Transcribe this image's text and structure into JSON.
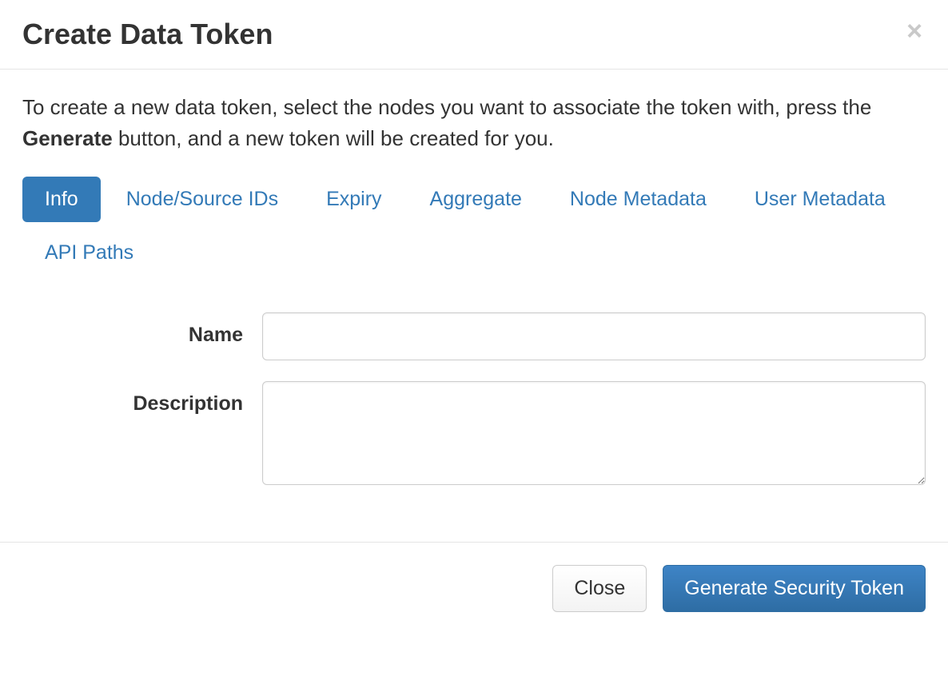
{
  "header": {
    "title": "Create Data Token",
    "close_glyph": "×"
  },
  "intro": {
    "pre": "To create a new data token, select the nodes you want to associate the token with, press the ",
    "bold": "Generate",
    "post": " button, and a new token will be created for you."
  },
  "tabs": [
    {
      "label": "Info",
      "active": true
    },
    {
      "label": "Node/Source IDs",
      "active": false
    },
    {
      "label": "Expiry",
      "active": false
    },
    {
      "label": "Aggregate",
      "active": false
    },
    {
      "label": "Node Metadata",
      "active": false
    },
    {
      "label": "User Metadata",
      "active": false
    },
    {
      "label": "API Paths",
      "active": false
    }
  ],
  "form": {
    "name_label": "Name",
    "name_value": "",
    "description_label": "Description",
    "description_value": ""
  },
  "footer": {
    "close_label": "Close",
    "generate_label": "Generate Security Token"
  }
}
